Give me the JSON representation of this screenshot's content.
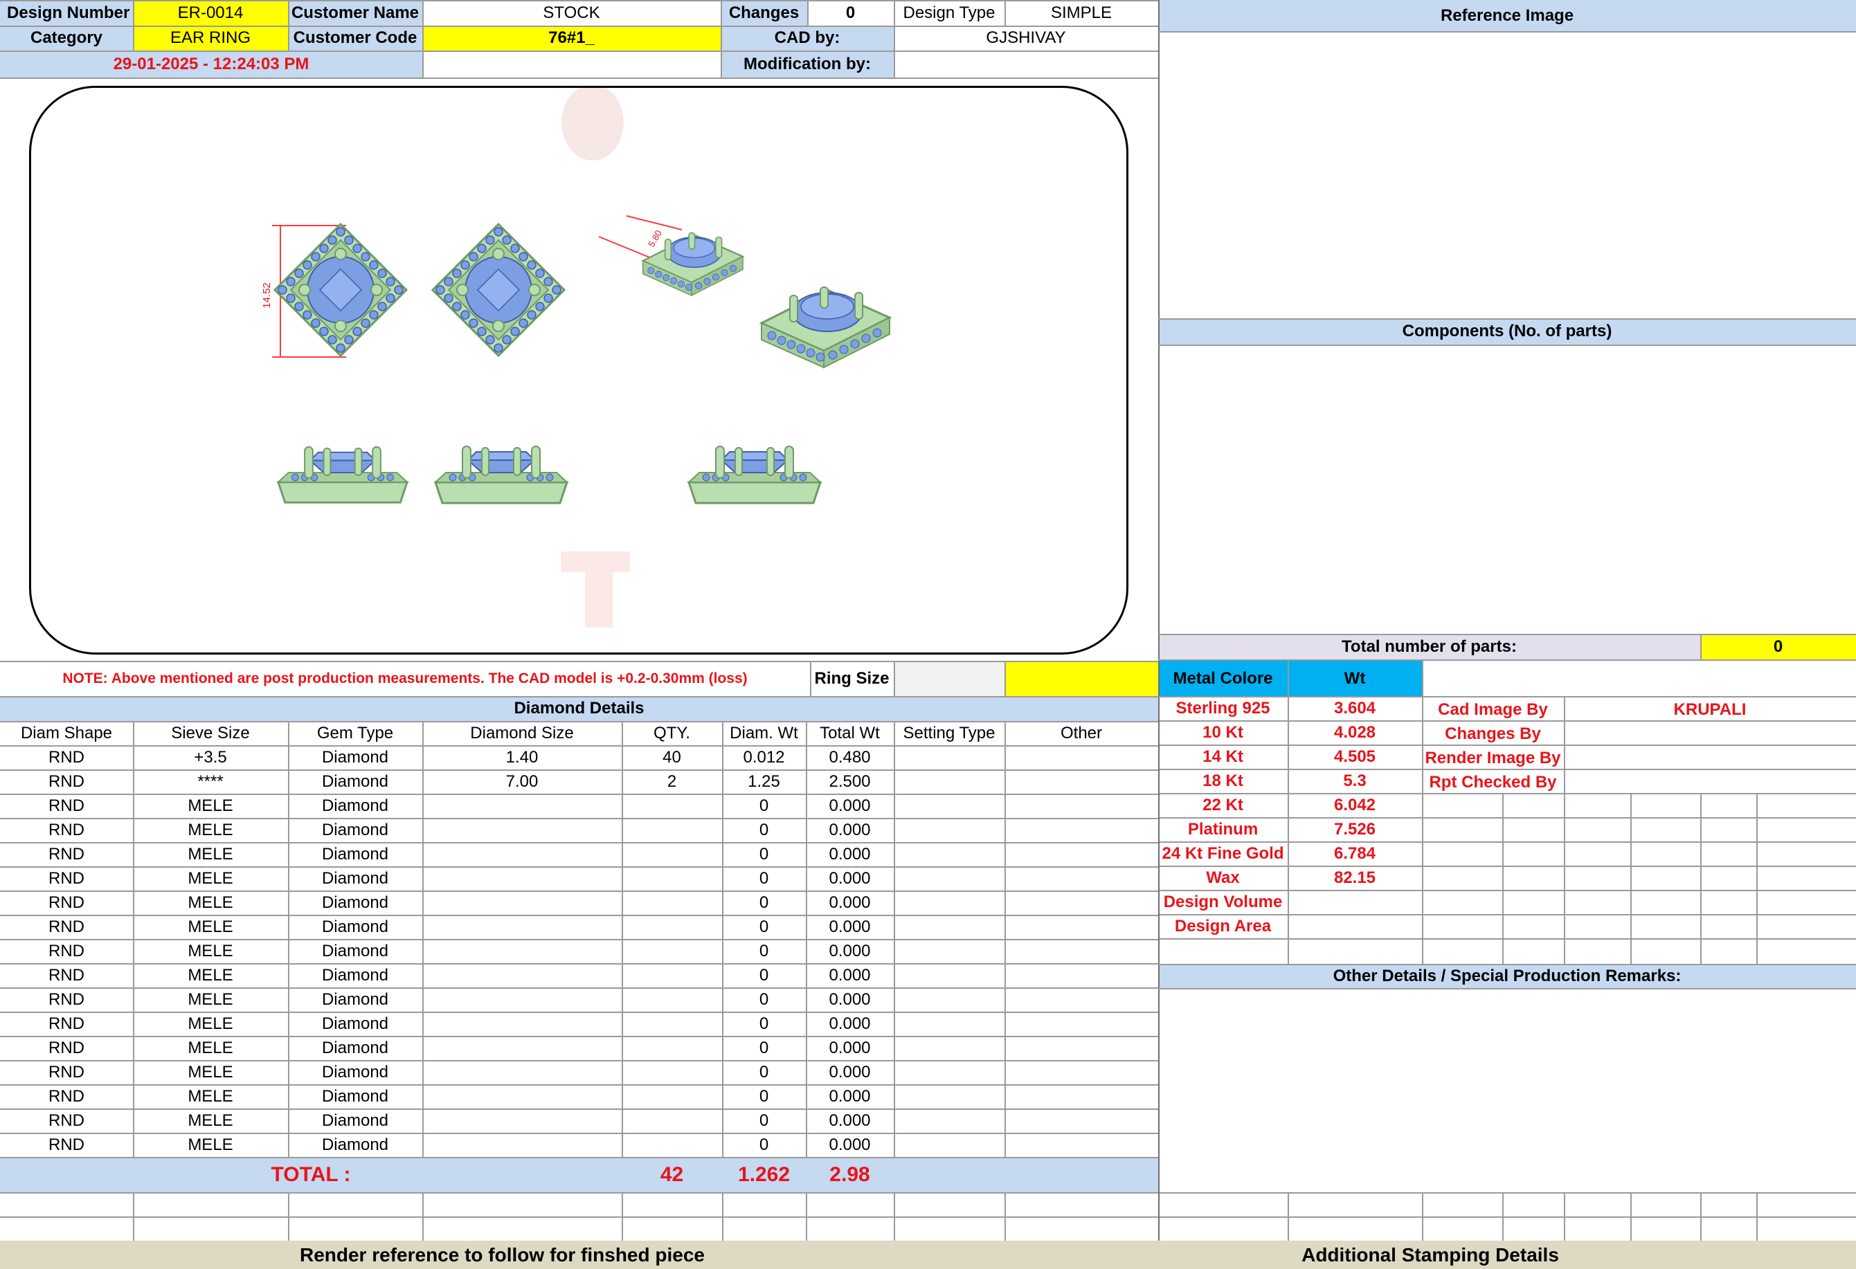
{
  "header": {
    "design_number_label": "Design Number",
    "design_number": "ER-0014",
    "customer_name_label": "Customer Name",
    "customer_name": "STOCK",
    "changes_label": "Changes",
    "changes": "0",
    "design_type_label": "Design Type",
    "design_type": "SIMPLE",
    "category_label": "Category",
    "category": "EAR RING",
    "customer_code_label": "Customer Code",
    "customer_code": "76#1_",
    "cad_by_label": "CAD by:",
    "cad_by": "GJSHIVAY",
    "timestamp": "29-01-2025 - 12:24:03 PM",
    "modification_by_label": "Modification by:",
    "modification_by": ""
  },
  "drawing": {
    "dimension_front": "14.52",
    "dimension_side": "5.80"
  },
  "note": "NOTE: Above mentioned are post production measurements. The CAD model is +0.2-0.30mm (loss)",
  "ring_size_label": "Ring Size",
  "ring_size": "",
  "diamond_details_title": "Diamond Details",
  "columns": [
    "Diam Shape",
    "Sieve Size",
    "Gem Type",
    "Diamond Size",
    "QTY.",
    "Diam. Wt",
    "Total Wt",
    "Setting Type",
    "Other"
  ],
  "rows": [
    [
      "RND",
      "+3.5",
      "Diamond",
      "1.40",
      "40",
      "0.012",
      "0.480",
      "",
      ""
    ],
    [
      "RND",
      "****",
      "Diamond",
      "7.00",
      "2",
      "1.25",
      "2.500",
      "",
      ""
    ],
    [
      "RND",
      "MELE",
      "Diamond",
      "",
      "",
      "0",
      "0.000",
      "",
      ""
    ],
    [
      "RND",
      "MELE",
      "Diamond",
      "",
      "",
      "0",
      "0.000",
      "",
      ""
    ],
    [
      "RND",
      "MELE",
      "Diamond",
      "",
      "",
      "0",
      "0.000",
      "",
      ""
    ],
    [
      "RND",
      "MELE",
      "Diamond",
      "",
      "",
      "0",
      "0.000",
      "",
      ""
    ],
    [
      "RND",
      "MELE",
      "Diamond",
      "",
      "",
      "0",
      "0.000",
      "",
      ""
    ],
    [
      "RND",
      "MELE",
      "Diamond",
      "",
      "",
      "0",
      "0.000",
      "",
      ""
    ],
    [
      "RND",
      "MELE",
      "Diamond",
      "",
      "",
      "0",
      "0.000",
      "",
      ""
    ],
    [
      "RND",
      "MELE",
      "Diamond",
      "",
      "",
      "0",
      "0.000",
      "",
      ""
    ],
    [
      "RND",
      "MELE",
      "Diamond",
      "",
      "",
      "0",
      "0.000",
      "",
      ""
    ],
    [
      "RND",
      "MELE",
      "Diamond",
      "",
      "",
      "0",
      "0.000",
      "",
      ""
    ],
    [
      "RND",
      "MELE",
      "Diamond",
      "",
      "",
      "0",
      "0.000",
      "",
      ""
    ],
    [
      "RND",
      "MELE",
      "Diamond",
      "",
      "",
      "0",
      "0.000",
      "",
      ""
    ],
    [
      "RND",
      "MELE",
      "Diamond",
      "",
      "",
      "0",
      "0.000",
      "",
      ""
    ],
    [
      "RND",
      "MELE",
      "Diamond",
      "",
      "",
      "0",
      "0.000",
      "",
      ""
    ],
    [
      "RND",
      "MELE",
      "Diamond",
      "",
      "",
      "0",
      "0.000",
      "",
      ""
    ]
  ],
  "total": {
    "label": "TOTAL :",
    "qty": "42",
    "diam_wt": "1.262",
    "total_wt": "2.98"
  },
  "footer": {
    "render_reference": "Render reference to follow for finshed piece",
    "stamping": "Additional Stamping Details"
  },
  "right": {
    "reference_image": "Reference Image",
    "components": "Components (No. of parts)",
    "total_parts_label": "Total number of parts:",
    "total_parts": "0",
    "metal_colore": "Metal Colore",
    "wt": "Wt",
    "metals": [
      {
        "name": "Sterling 925",
        "wt": "3.604"
      },
      {
        "name": "10 Kt",
        "wt": "4.028"
      },
      {
        "name": "14 Kt",
        "wt": "4.505"
      },
      {
        "name": "18 Kt",
        "wt": "5.3"
      },
      {
        "name": "22 Kt",
        "wt": "6.042"
      },
      {
        "name": "Platinum",
        "wt": "7.526"
      },
      {
        "name": "24 Kt Fine Gold",
        "wt": "6.784"
      },
      {
        "name": "Wax",
        "wt": "82.15"
      },
      {
        "name": "Design Volume",
        "wt": ""
      },
      {
        "name": "Design Area",
        "wt": ""
      }
    ],
    "cad_image_by_label": "Cad Image By",
    "cad_image_by": "KRUPALI",
    "changes_by_label": "Changes By",
    "changes_by": "",
    "render_image_by_label": "Render Image By",
    "render_image_by": "",
    "rpt_checked_by_label": "Rpt Checked By",
    "rpt_checked_by": "",
    "other_details": "Other Details / Special Production Remarks:"
  },
  "colors": {
    "metal": "#b9dfb0",
    "stone": "#7c9ee3",
    "yellow": "#ffff00",
    "blue_header": "#c5d9f1",
    "cyan": "#00b0f0",
    "red_text": "#e8141b"
  }
}
